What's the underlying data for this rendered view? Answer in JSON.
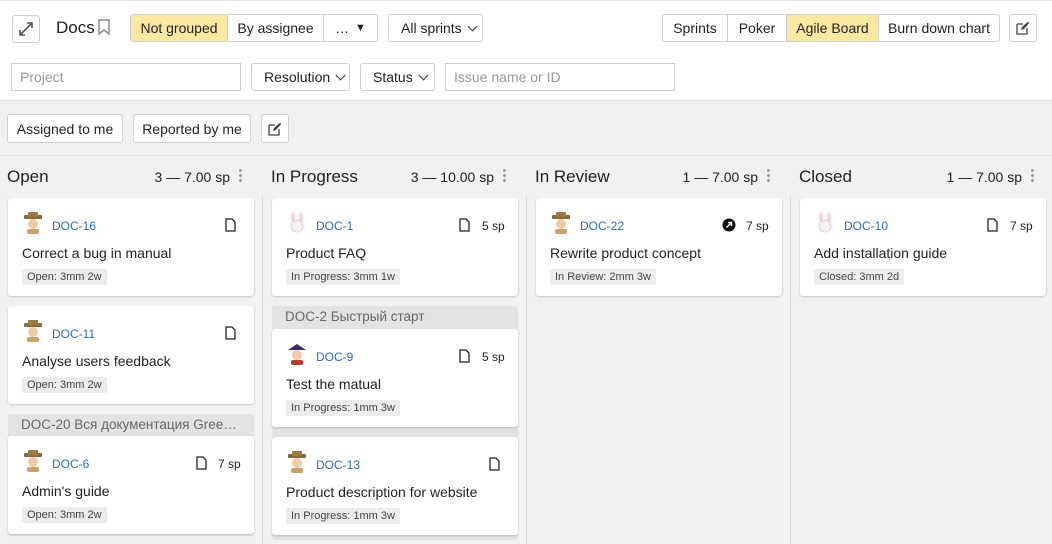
{
  "header": {
    "title": "Docs",
    "grouping": [
      "Not grouped",
      "By assignee",
      "…"
    ],
    "sprints_label": "All sprints",
    "views": [
      "Sprints",
      "Poker",
      "Agile Board",
      "Burn down chart"
    ],
    "colors": {
      "active": "#fbe9a3",
      "link": "#2a6bc3"
    }
  },
  "filters": {
    "project_placeholder": "Project",
    "resolution_label": "Resolution",
    "status_label": "Status",
    "issue_placeholder": "Issue name or ID"
  },
  "quick": {
    "assigned_label": "Assigned to me",
    "reported_label": "Reported by me"
  },
  "columns": [
    {
      "title": "Open",
      "count": "3 — 7.00 sp",
      "cards": [
        {
          "key": "DOC-16",
          "sp": "",
          "summary": "Correct a bug in manual",
          "status": "Open: 3mm 2w",
          "avatar": "cowboy-avatar-icon",
          "type_icon": "document-icon"
        },
        {
          "key": "DOC-11",
          "sp": "",
          "summary": "Analyse users feedback",
          "status": "Open: 3mm 2w",
          "avatar": "cowboy-avatar-icon",
          "type_icon": "document-icon"
        }
      ],
      "epic": {
        "title": "DOC-20 Вся документация Green …",
        "cards": [
          {
            "key": "DOC-6",
            "sp": "7 sp",
            "summary": "Admin's guide",
            "status": "Open: 3mm 2w",
            "avatar": "cowboy-avatar-icon",
            "type_icon": "document-icon"
          }
        ]
      }
    },
    {
      "title": "In Progress",
      "count": "3 — 10.00 sp",
      "cards": [
        {
          "key": "DOC-1",
          "sp": "5 sp",
          "summary": "Product FAQ",
          "status": "In Progress: 3mm 1w",
          "avatar": "rabbit-avatar-icon",
          "type_icon": "document-icon"
        }
      ],
      "epic": {
        "title": "DOC-2 Быстрый старт",
        "cards": [
          {
            "key": "DOC-9",
            "sp": "5 sp",
            "summary": "Test the matual",
            "status": "In Progress: 1mm 3w",
            "avatar": "pirate-avatar-icon",
            "type_icon": "document-icon"
          },
          {
            "key": "DOC-13",
            "sp": "",
            "summary": "Product description for website",
            "status": "In Progress: 1mm 3w",
            "avatar": "cowboy-avatar-icon",
            "type_icon": "document-icon"
          }
        ]
      }
    },
    {
      "title": "In Review",
      "count": "1 — 7.00 sp",
      "cards": [
        {
          "key": "DOC-22",
          "sp": "7 sp",
          "summary": "Rewrite product concept",
          "status": "In Review: 2mm 3w",
          "avatar": "cowboy-avatar-icon",
          "type_icon": "arrow-circle-icon"
        }
      ]
    },
    {
      "title": "Closed",
      "count": "1 — 7.00 sp",
      "cards": [
        {
          "key": "DOC-10",
          "sp": "7 sp",
          "summary": "Add installation guide",
          "status": "Closed: 3mm 2d",
          "avatar": "rabbit-avatar-icon",
          "type_icon": "document-icon"
        }
      ]
    }
  ]
}
